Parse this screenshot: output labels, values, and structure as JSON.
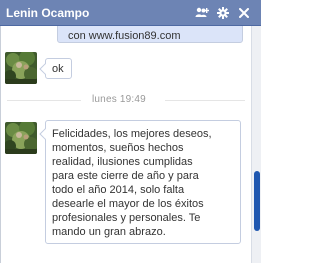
{
  "window": {
    "title": "Lenin Ocampo",
    "icons": [
      "add-friend-icon",
      "gear-icon",
      "close-icon"
    ]
  },
  "messages": {
    "top_partial": "con www.fusion89.com",
    "ok": "ok",
    "timestamp": "lunes 19:49",
    "long_lines": [
      "Felicidades, los mejores deseos,",
      "momentos, sueños hechos",
      "realidad, ilusiones cumplidas",
      "para este cierre de año y para",
      "todo el año 2014, solo falta",
      "desearle el mayor de los éxitos",
      "profesionales y personales. Te",
      "mando un gran abrazo."
    ]
  },
  "colors": {
    "titlebar": "#6d84b4",
    "own_bubble": "#dbe4f9",
    "scroll_thumb": "#1f57b0"
  }
}
